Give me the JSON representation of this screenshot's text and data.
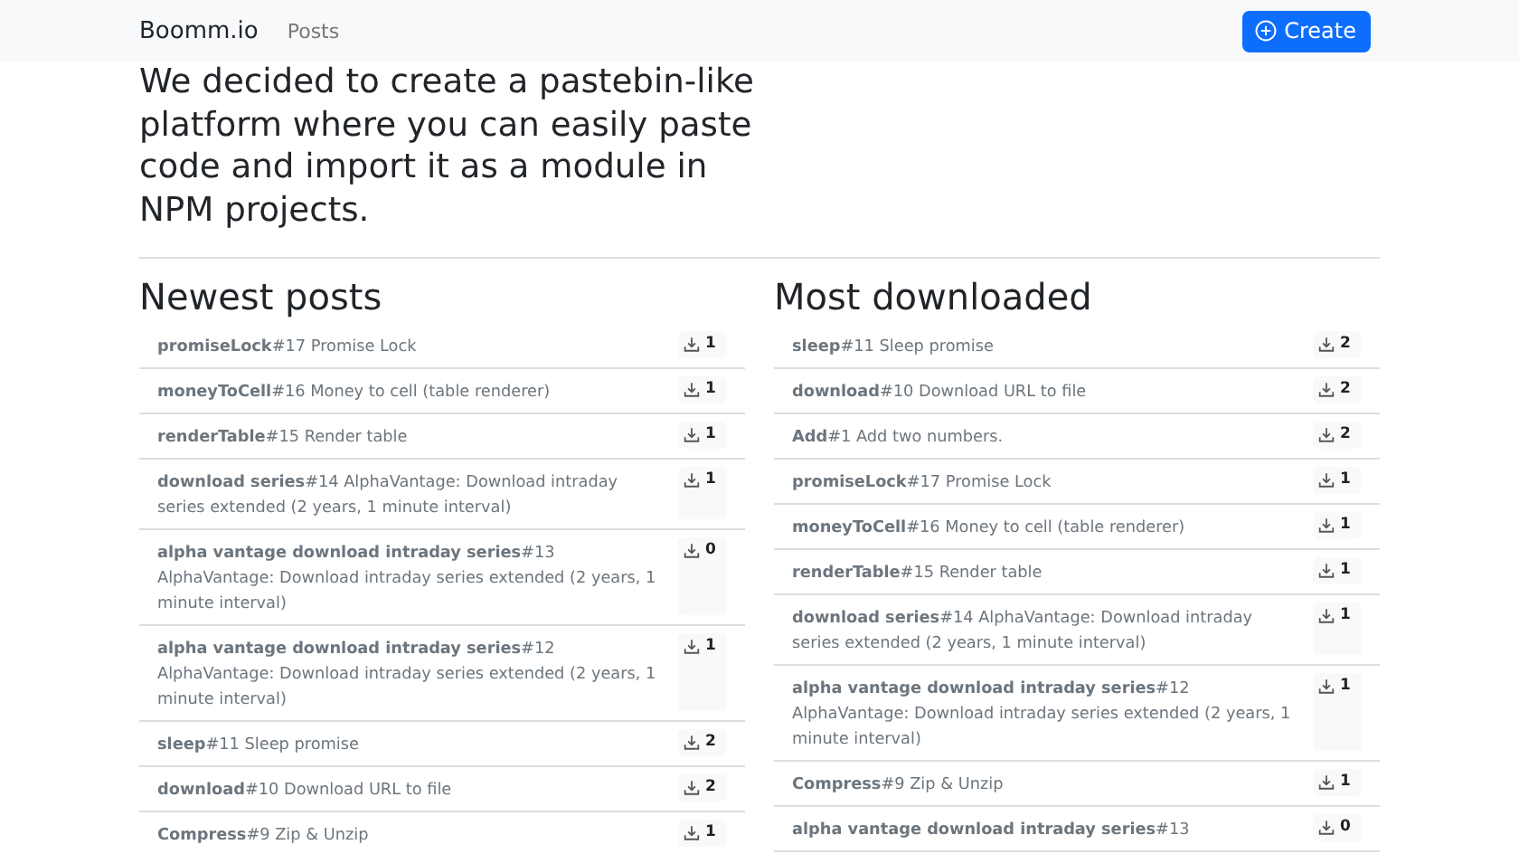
{
  "navbar": {
    "brand": "Boomm.io",
    "links": [
      {
        "label": "Posts"
      }
    ],
    "create_button": "Create"
  },
  "intro": "We decided to create a pastebin-like platform where you can easily paste code and import it as a module in NPM projects.",
  "sections": [
    {
      "title": "Newest posts",
      "posts": [
        {
          "title": "**promiseLock**#17 Promise Lock",
          "downloads": "1"
        },
        {
          "title": "**moneyToCell**#16 Money to cell (table renderer)",
          "downloads": "1"
        },
        {
          "title": "**renderTable**#15 Render table",
          "downloads": "1"
        },
        {
          "title": "**download series**#14 AlphaVantage: Download intraday series extended (2 years, 1 minute interval)",
          "downloads": "1"
        },
        {
          "title": "**alpha vantage download intraday series**#13 AlphaVantage: Download intraday series extended (2 years, 1 minute interval)",
          "downloads": "0"
        },
        {
          "title": "**alpha vantage download intraday series**#12 AlphaVantage: Download intraday series extended (2 years, 1 minute interval)",
          "downloads": "1"
        },
        {
          "title": "**sleep**#11 Sleep promise",
          "downloads": "2"
        },
        {
          "title": "**download**#10 Download URL to file",
          "downloads": "2"
        },
        {
          "title": "**Compress**#9 Zip & Unzip",
          "downloads": "1"
        }
      ]
    },
    {
      "title": "Most downloaded",
      "posts": [
        {
          "title": "**sleep**#11 Sleep promise",
          "downloads": "2"
        },
        {
          "title": "**download**#10 Download URL to file",
          "downloads": "2"
        },
        {
          "title": "**Add**#1 Add two numbers.",
          "downloads": "2"
        },
        {
          "title": "**promiseLock**#17 Promise Lock",
          "downloads": "1"
        },
        {
          "title": "**moneyToCell**#16 Money to cell (table renderer)",
          "downloads": "1"
        },
        {
          "title": "**renderTable**#15 Render table",
          "downloads": "1"
        },
        {
          "title": "**download series**#14 AlphaVantage: Download intraday series extended (2 years, 1 minute interval)",
          "downloads": "1"
        },
        {
          "title": "**alpha vantage download intraday series**#12 AlphaVantage: Download intraday series extended (2 years, 1 minute interval)",
          "downloads": "1"
        },
        {
          "title": "**Compress**#9 Zip & Unzip",
          "downloads": "1"
        },
        {
          "title": "**alpha vantage download intraday series**#13",
          "downloads": "0"
        }
      ]
    }
  ]
}
